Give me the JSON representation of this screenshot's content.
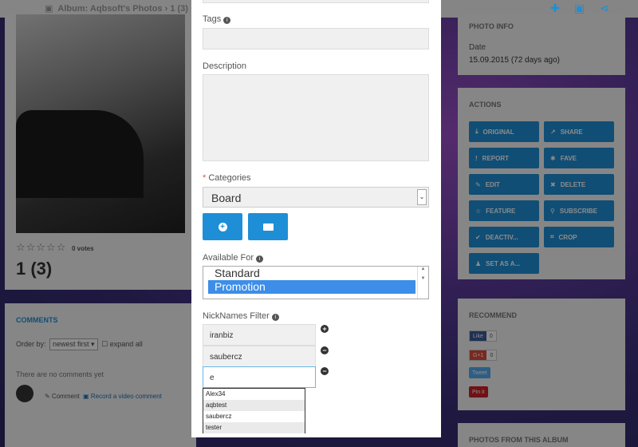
{
  "header": {
    "title": "Album: Aqbsoft's Photos",
    "page": "1 (3)"
  },
  "photo": {
    "votes": "0 votes",
    "title": "1 (3)"
  },
  "comments": {
    "heading": "COMMENTS",
    "order_label": "Order by:",
    "order_value": "newest first",
    "expand_label": "expand all",
    "empty_text": "There are no comments yet",
    "comment_link": "Comment",
    "video_link": "Record a video comment"
  },
  "photo_info": {
    "heading": "PHOTO INFO",
    "date_label": "Date",
    "date_value": "15.09.2015 (72 days ago)"
  },
  "actions": {
    "heading": "ACTIONS",
    "buttons": [
      "ORIGINAL",
      "SHARE",
      "REPORT",
      "FAVE",
      "EDIT",
      "DELETE",
      "FEATURE",
      "SUBSCRIBE",
      "DEACTIV...",
      "CROP",
      "SET AS A..."
    ],
    "icons": [
      "download-icon",
      "share-icon",
      "report-icon",
      "fave-icon",
      "edit-icon",
      "delete-icon",
      "feature-icon",
      "subscribe-icon",
      "deactivate-icon",
      "crop-icon",
      "set-avatar-icon"
    ]
  },
  "recommend": {
    "heading": "RECOMMEND",
    "like_label": "Like",
    "like_count": "0",
    "gplus_label": "G+1",
    "gplus_count": "0",
    "tweet_label": "Tweet",
    "pinit_label": "Pin it"
  },
  "photos_album_heading": "PHOTOS FROM THIS ALBUM",
  "form": {
    "tags_label": "Tags",
    "description_label": "Description",
    "categories_label": "Categories",
    "categories_value": "Board",
    "available_label": "Available For",
    "available_options": [
      "Standard",
      "Promotion"
    ],
    "available_selected": "Promotion",
    "nick_label": "NickNames Filter",
    "nick_values": [
      "iranbiz",
      "saubercz",
      "e"
    ],
    "suggestions": [
      "Alex34",
      "aqbtest",
      "saubercz",
      "tester"
    ]
  },
  "colors": {
    "accent": "#1e8fd6"
  }
}
